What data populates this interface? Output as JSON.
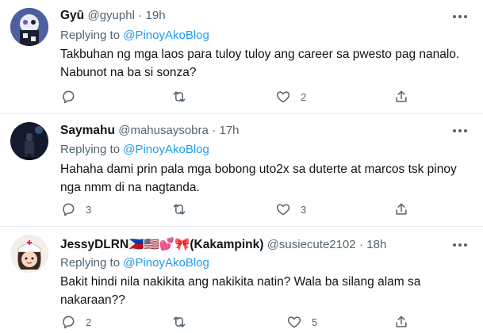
{
  "tweets": [
    {
      "display_name": "Gyū",
      "handle": "@gyuphl",
      "time": "19h",
      "replying_label": "Replying to",
      "replying_to": "@PinoyAkoBlog",
      "text_line1": "Takbuhan ng mga laos para tuloy tuloy ang career sa pwesto pag nanalo.",
      "text_line2": "Nabunot na ba si sonza?",
      "reply_count": "",
      "like_count": "2"
    },
    {
      "display_name": "Saymahu",
      "handle": "@mahusaysobra",
      "time": "17h",
      "replying_label": "Replying to",
      "replying_to": "@PinoyAkoBlog",
      "text_line1": "Hahaha dami prin pala mga bobong uto2x sa duterte at marcos tsk pinoy",
      "text_line2": "nga nmm di na nagtanda.",
      "reply_count": "3",
      "like_count": "3"
    },
    {
      "display_name": "JessyDLRN🇵🇭🇺🇸💕🎀(Kakampink)",
      "handle": "@susiecute2102",
      "time": "18h",
      "replying_label": "Replying to",
      "replying_to": "@PinoyAkoBlog",
      "text_line1": "Bakit hindi nila nakikita ang nakikita natin? Wala ba silang alam sa",
      "text_line2": "nakaraan??",
      "reply_count": "2",
      "like_count": "5"
    }
  ],
  "dot": "·",
  "icons": {
    "reply": "reply-icon",
    "retweet": "retweet-icon",
    "like": "heart-icon",
    "share": "share-icon",
    "more": "more-icon"
  },
  "colors": {
    "link": "#1d9bf0",
    "secondary": "#536471",
    "divider": "#e6ecf0"
  }
}
